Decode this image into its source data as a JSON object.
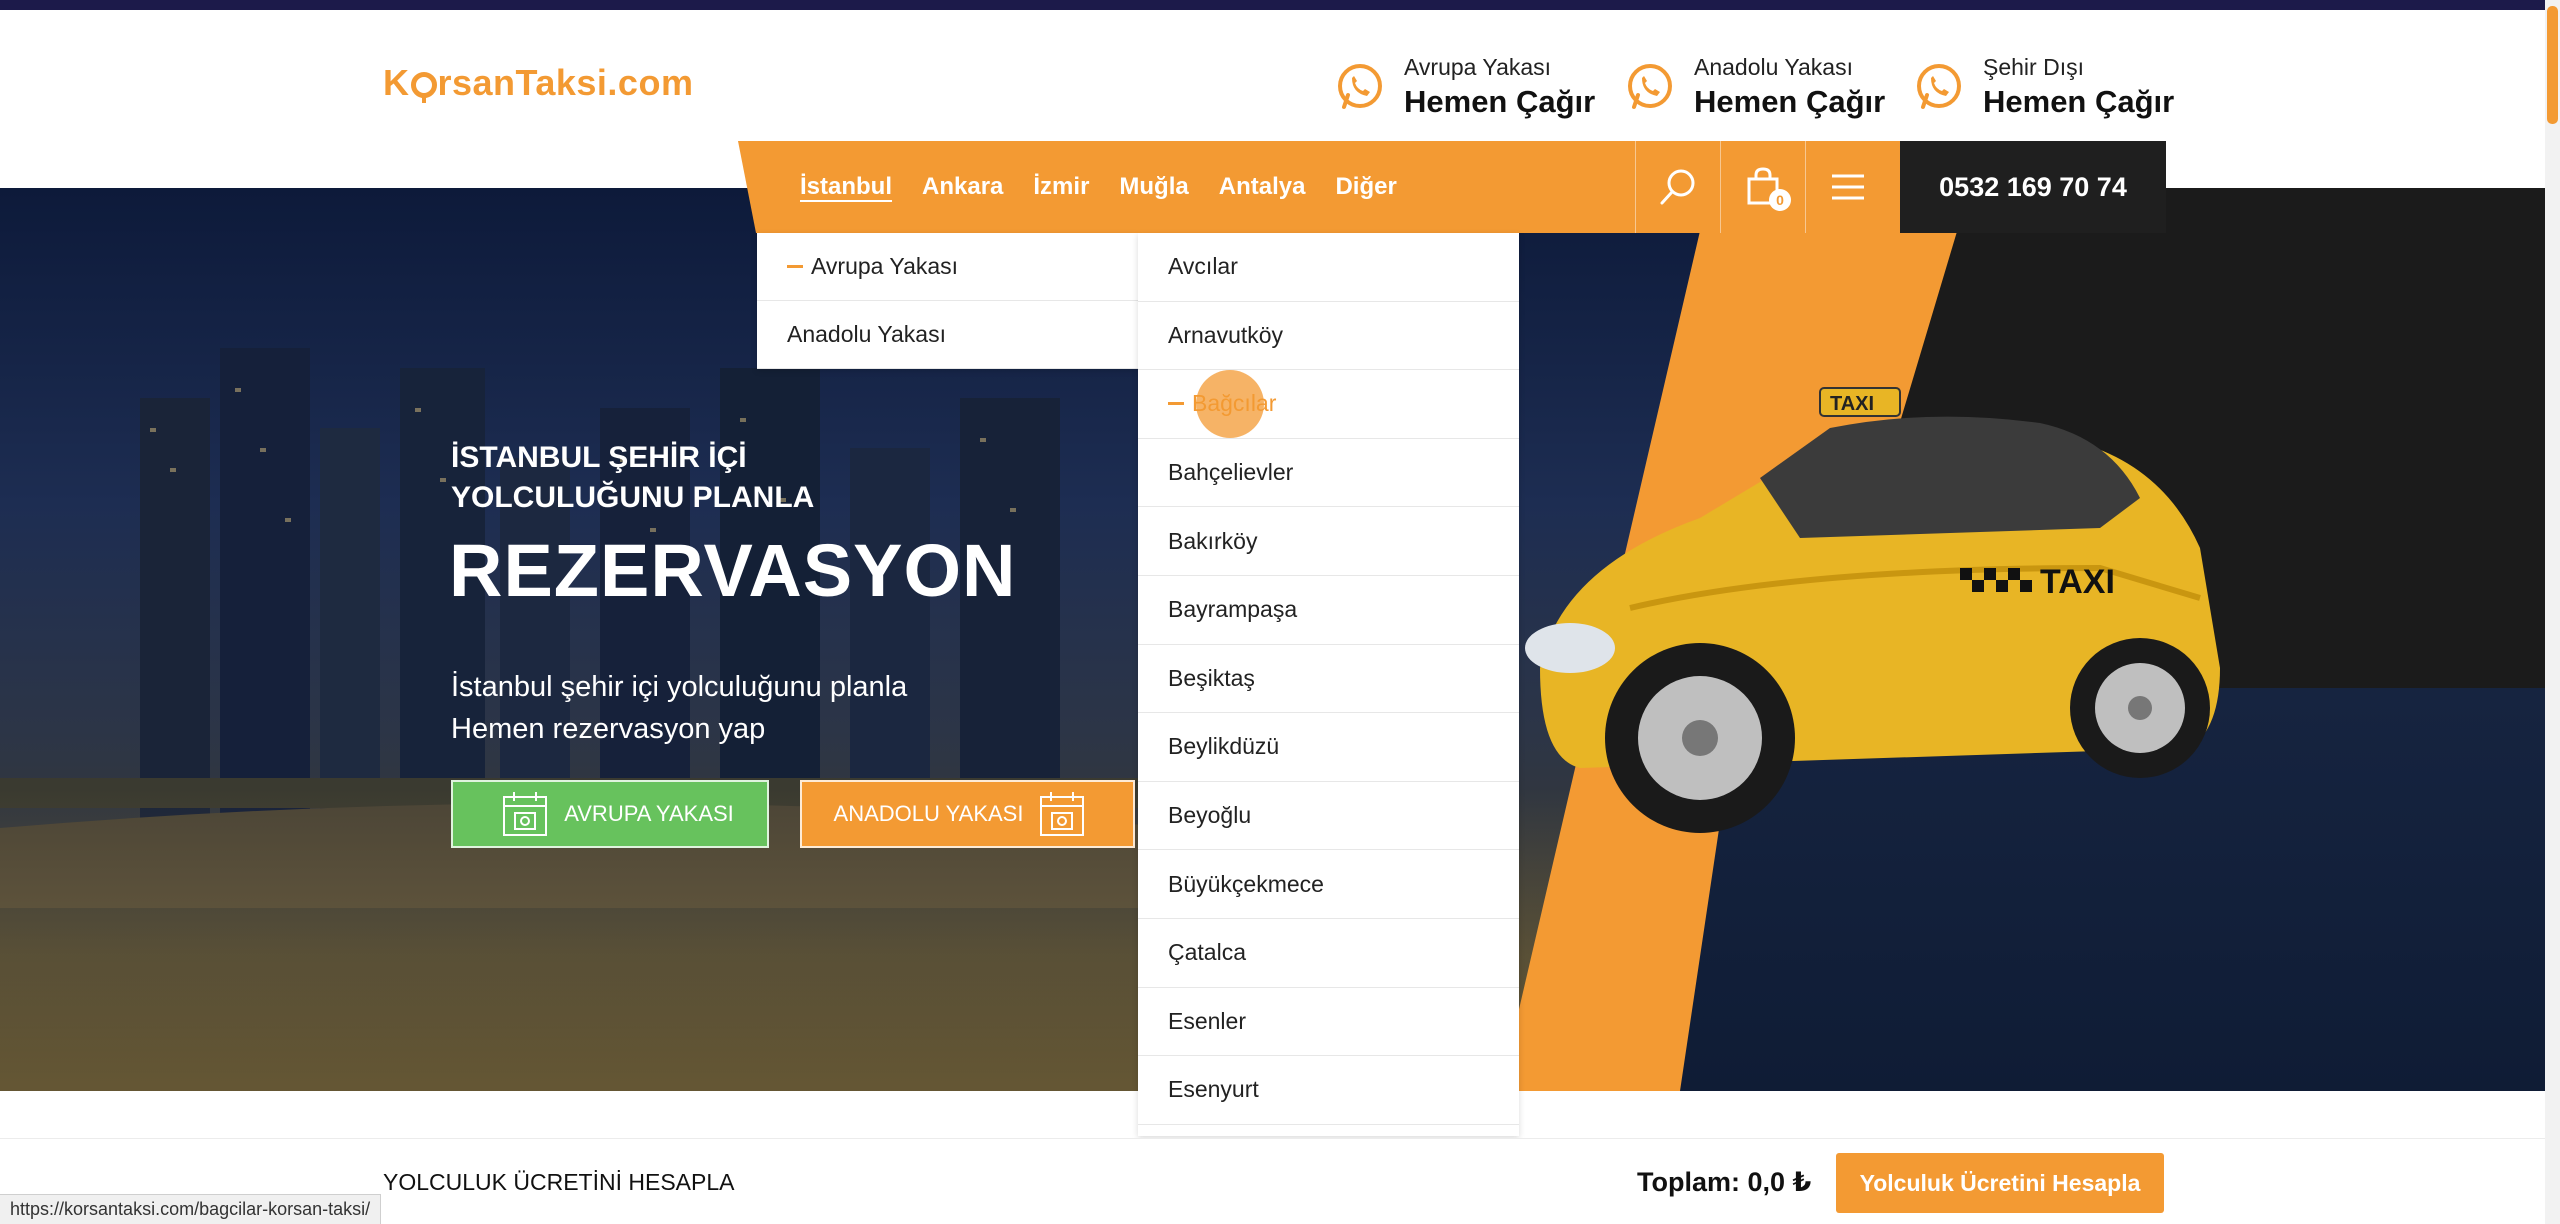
{
  "header": {
    "logo": {
      "before": "K",
      "after": "rsanTaksi.com"
    },
    "calls": [
      {
        "region": "Avrupa Yakası",
        "label": "Hemen Çağır"
      },
      {
        "region": "Anadolu Yakası",
        "label": "Hemen Çağır"
      },
      {
        "region": "Şehir Dışı",
        "label": "Hemen Çağır"
      }
    ]
  },
  "nav": {
    "links": [
      "İstanbul",
      "Ankara",
      "İzmir",
      "Muğla",
      "Antalya",
      "Diğer"
    ],
    "cart_count": "0",
    "phone": "0532 169 70 74"
  },
  "hero": {
    "subtitle_line1": "İSTANBUL ŞEHİR İÇİ",
    "subtitle_line2": "YOLCULUĞUNU PLANLA",
    "title": "REZERVASYON",
    "desc_line1": "İstanbul şehir içi yolculuğunu planla",
    "desc_line2": "Hemen rezervasyon yap",
    "btn_europe": "AVRUPA YAKASI",
    "btn_anatolia": "ANADOLU YAKASI"
  },
  "dropdown_regions": [
    "Avrupa Yakası",
    "Anadolu Yakası"
  ],
  "dropdown_districts": [
    "Avcılar",
    "Arnavutköy",
    "Bağcılar",
    "Bahçelievler",
    "Bakırköy",
    "Bayrampaşa",
    "Beşiktaş",
    "Beylikdüzü",
    "Beyoğlu",
    "Büyükçekmece",
    "Çatalca",
    "Esenler",
    "Esenyurt"
  ],
  "bottom": {
    "title": "YOLCULUK ÜCRETİNİ HESAPLA",
    "total": "Toplam: 0,0 ₺",
    "calc_button": "Yolculuk Ücretini Hesapla"
  },
  "status_url": "https://korsantaksi.com/bagcilar-korsan-taksi/",
  "colors": {
    "accent": "#f39a33",
    "green": "#67c25d",
    "dark": "#1f1f1f",
    "topbar": "#1c1a4a"
  }
}
